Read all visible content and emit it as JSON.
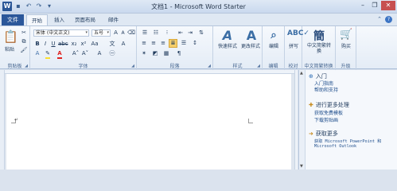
{
  "window": {
    "title": "文档1 - Microsoft Word Starter",
    "app_logo": "W",
    "qat": [
      "save-icon",
      "undo-icon",
      "redo-icon",
      "customize-icon"
    ],
    "controls": [
      "minimize",
      "restore",
      "close"
    ]
  },
  "tabs": {
    "file": "文件",
    "items": [
      "开始",
      "插入",
      "页面布局",
      "邮件"
    ],
    "active": "开始"
  },
  "ribbon": {
    "clipboard": {
      "label": "剪贴板",
      "paste": "粘贴"
    },
    "font": {
      "label": "字体",
      "font_name": "宋体 (中文正文)",
      "font_size": "五号"
    },
    "paragraph": {
      "label": "段落"
    },
    "styles": {
      "label": "样式",
      "quick_styles": "快速样式",
      "change_styles": "更改样式"
    },
    "editing": {
      "label": "编辑",
      "button": "编辑"
    },
    "proofing": {
      "label": "校对",
      "button": "拼写"
    },
    "chinese_convert": {
      "label": "中文简繁转换",
      "button": "中文简繁转换"
    },
    "upgrade": {
      "label": "升级",
      "button": "购买"
    }
  },
  "task_pane": {
    "sections": [
      {
        "title": "入门",
        "links": [
          "入门指南",
          "帮助和支持"
        ]
      },
      {
        "title": "进行更多处理",
        "links": [
          "获取免费模板",
          "下载剪贴画"
        ]
      },
      {
        "title": "获取更多",
        "links": [
          "获取 Microsoft PowerPoint 和 Microsoft Outlook"
        ]
      }
    ]
  },
  "colors": {
    "accent": "#2b579a",
    "close": "#c75050",
    "highlight": "#fbde2f",
    "font_red": "#e0221f"
  }
}
